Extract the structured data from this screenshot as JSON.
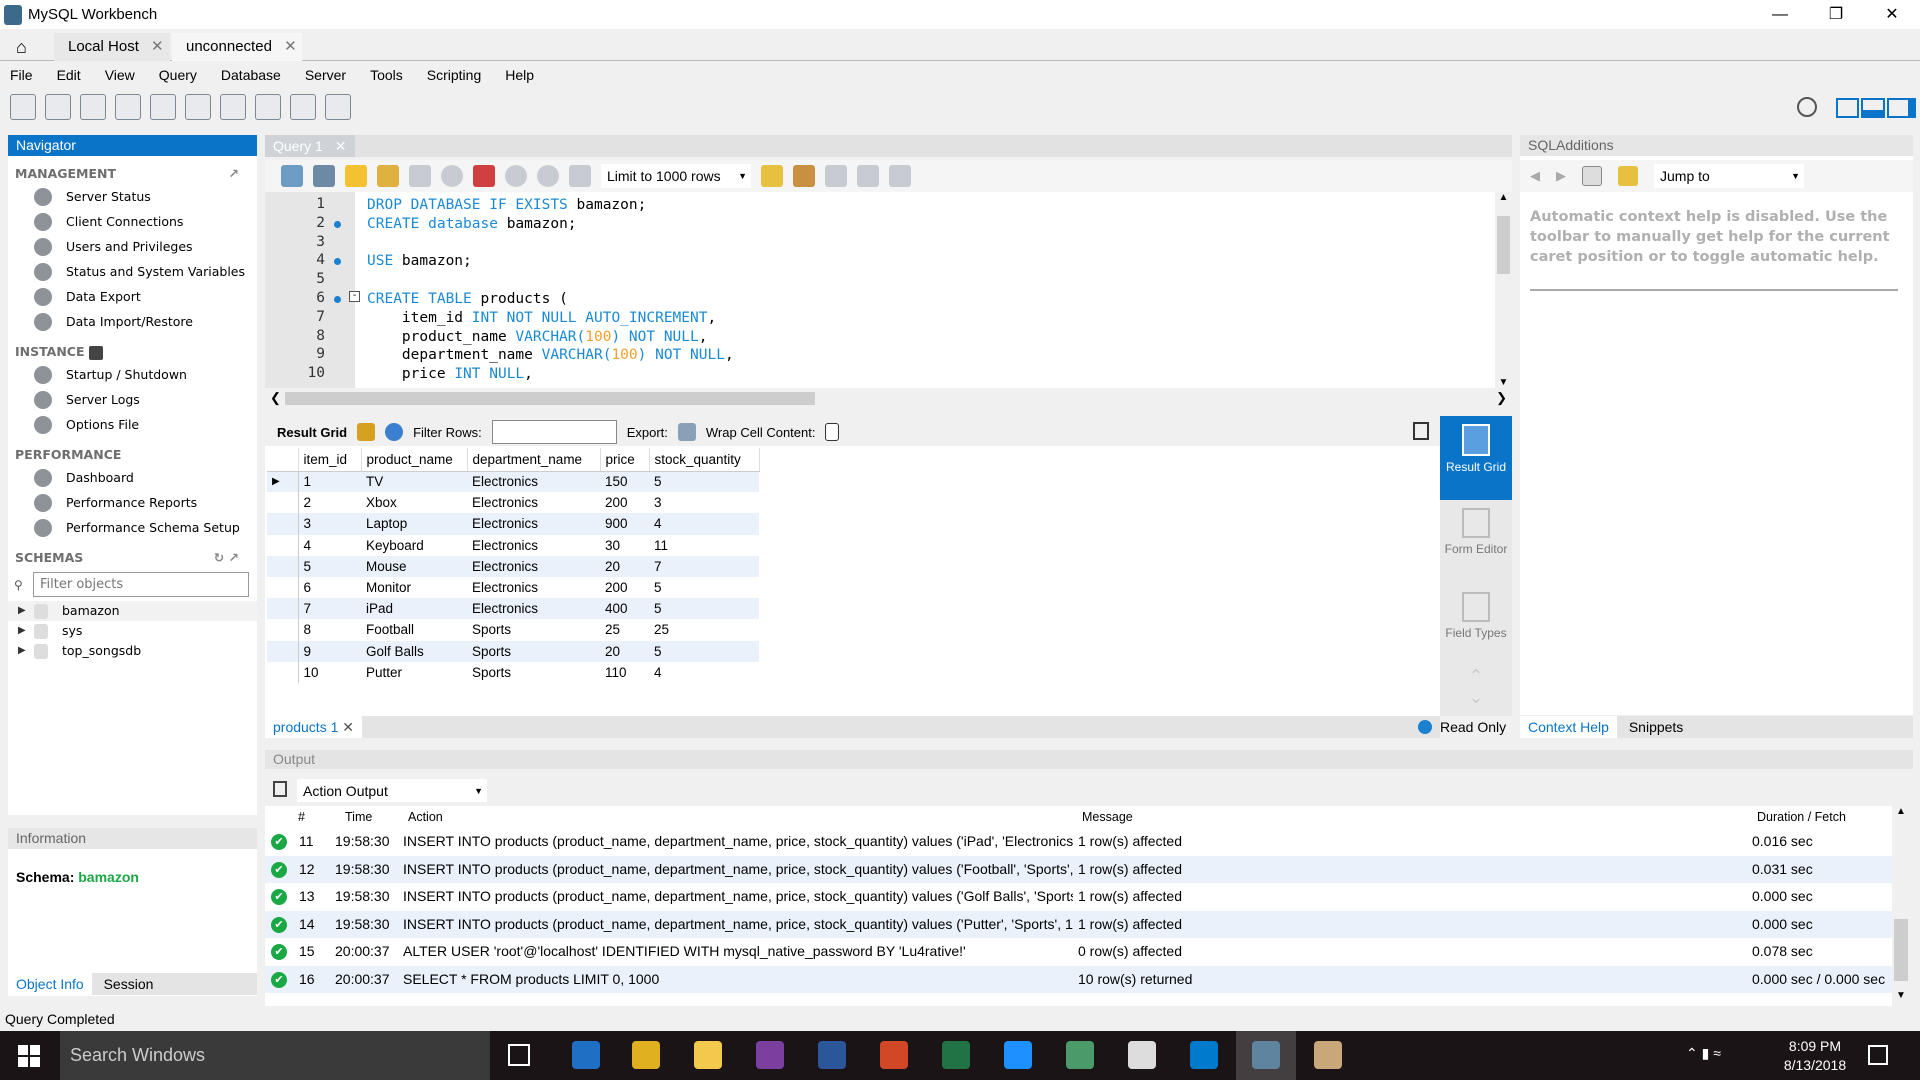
{
  "window": {
    "title": "MySQL Workbench",
    "controls": [
      "minimize",
      "restore",
      "close"
    ]
  },
  "conn_tabs": [
    {
      "label": "Local Host"
    },
    {
      "label": "unconnected"
    }
  ],
  "menu": [
    "File",
    "Edit",
    "View",
    "Query",
    "Database",
    "Server",
    "Tools",
    "Scripting",
    "Help"
  ],
  "navigator": {
    "title": "Navigator",
    "management": {
      "title": "MANAGEMENT",
      "items": [
        "Server Status",
        "Client Connections",
        "Users and Privileges",
        "Status and System Variables",
        "Data Export",
        "Data Import/Restore"
      ]
    },
    "instance": {
      "title": "INSTANCE",
      "items": [
        "Startup / Shutdown",
        "Server Logs",
        "Options File"
      ]
    },
    "performance": {
      "title": "PERFORMANCE",
      "items": [
        "Dashboard",
        "Performance Reports",
        "Performance Schema Setup"
      ]
    },
    "schemas": {
      "title": "SCHEMAS",
      "filter_placeholder": "Filter objects",
      "items": [
        "bamazon",
        "sys",
        "top_songsdb"
      ]
    }
  },
  "information": {
    "title": "Information",
    "schema_label": "Schema:",
    "schema_value": "bamazon",
    "tabs": [
      "Object Info",
      "Session"
    ]
  },
  "query": {
    "tab": "Query 1",
    "limit": "Limit to 1000 rows",
    "code": [
      {
        "n": "1",
        "dot": false,
        "parts": [
          [
            "kw",
            "DROP DATABASE IF EXISTS "
          ],
          [
            "",
            "bamazon;"
          ]
        ]
      },
      {
        "n": "2",
        "dot": true,
        "parts": [
          [
            "kw",
            "CREATE database "
          ],
          [
            "",
            "bamazon;"
          ]
        ]
      },
      {
        "n": "3",
        "dot": false,
        "parts": []
      },
      {
        "n": "4",
        "dot": true,
        "parts": [
          [
            "kw",
            "USE "
          ],
          [
            "",
            "bamazon;"
          ]
        ]
      },
      {
        "n": "5",
        "dot": false,
        "parts": []
      },
      {
        "n": "6",
        "dot": true,
        "parts": [
          [
            "kw",
            "CREATE TABLE "
          ],
          [
            "",
            "products ("
          ]
        ]
      },
      {
        "n": "7",
        "dot": false,
        "parts": [
          [
            "",
            "    item_id "
          ],
          [
            "kw",
            "INT NOT NULL AUTO_INCREMENT"
          ],
          [
            "",
            ","
          ]
        ]
      },
      {
        "n": "8",
        "dot": false,
        "parts": [
          [
            "",
            "    product_name "
          ],
          [
            "kw",
            "VARCHAR("
          ],
          [
            "num",
            "100"
          ],
          [
            "kw",
            ") NOT NULL"
          ],
          [
            "",
            ","
          ]
        ]
      },
      {
        "n": "9",
        "dot": false,
        "parts": [
          [
            "",
            "    department_name "
          ],
          [
            "kw",
            "VARCHAR("
          ],
          [
            "num",
            "100"
          ],
          [
            "kw",
            ") NOT NULL"
          ],
          [
            "",
            ","
          ]
        ]
      },
      {
        "n": "10",
        "dot": false,
        "parts": [
          [
            "",
            "    price "
          ],
          [
            "kw",
            "INT NULL"
          ],
          [
            "",
            ","
          ]
        ]
      }
    ]
  },
  "result": {
    "toolbar": {
      "result_grid": "Result Grid",
      "filter_rows": "Filter Rows:",
      "export": "Export:",
      "wrap": "Wrap Cell Content:"
    },
    "columns": [
      "item_id",
      "product_name",
      "department_name",
      "price",
      "stock_quantity"
    ],
    "rows": [
      [
        "1",
        "TV",
        "Electronics",
        "150",
        "5"
      ],
      [
        "2",
        "Xbox",
        "Electronics",
        "200",
        "3"
      ],
      [
        "3",
        "Laptop",
        "Electronics",
        "900",
        "4"
      ],
      [
        "4",
        "Keyboard",
        "Electronics",
        "30",
        "11"
      ],
      [
        "5",
        "Mouse",
        "Electronics",
        "20",
        "7"
      ],
      [
        "6",
        "Monitor",
        "Electronics",
        "200",
        "5"
      ],
      [
        "7",
        "iPad",
        "Electronics",
        "400",
        "5"
      ],
      [
        "8",
        "Football",
        "Sports",
        "25",
        "25"
      ],
      [
        "9",
        "Golf Balls",
        "Sports",
        "20",
        "5"
      ],
      [
        "10",
        "Putter",
        "Sports",
        "110",
        "4"
      ]
    ],
    "side_buttons": [
      "Result Grid",
      "Form Editor",
      "Field Types"
    ],
    "tab": "products 1",
    "read_only": "Read Only"
  },
  "sql_additions": {
    "title": "SQLAdditions",
    "jump_to": "Jump to",
    "help_text": "Automatic context help is disabled. Use the toolbar to manually get help for the current caret position or to toggle automatic help.",
    "tabs": [
      "Context Help",
      "Snippets"
    ]
  },
  "output": {
    "title": "Output",
    "selector": "Action Output",
    "columns": [
      "#",
      "Time",
      "Action",
      "Message",
      "Duration / Fetch"
    ],
    "rows": [
      {
        "n": "11",
        "time": "19:58:30",
        "action": "INSERT INTO products (product_name, department_name, price, stock_quantity) values ('iPad', 'Electronics', ...",
        "message": "1 row(s) affected",
        "duration": "0.016 sec"
      },
      {
        "n": "12",
        "time": "19:58:30",
        "action": "INSERT INTO products (product_name, department_name, price, stock_quantity) values ('Football', 'Sports', 2...",
        "message": "1 row(s) affected",
        "duration": "0.031 sec"
      },
      {
        "n": "13",
        "time": "19:58:30",
        "action": "INSERT INTO products (product_name, department_name, price, stock_quantity) values ('Golf Balls', 'Sports', ...",
        "message": "1 row(s) affected",
        "duration": "0.000 sec"
      },
      {
        "n": "14",
        "time": "19:58:30",
        "action": "INSERT INTO products (product_name, department_name, price, stock_quantity) values ('Putter', 'Sports', 110...",
        "message": "1 row(s) affected",
        "duration": "0.000 sec"
      },
      {
        "n": "15",
        "time": "20:00:37",
        "action": "ALTER USER 'root'@'localhost' IDENTIFIED WITH mysql_native_password BY 'Lu4rative!'",
        "message": "0 row(s) affected",
        "duration": "0.078 sec"
      },
      {
        "n": "16",
        "time": "20:00:37",
        "action": "SELECT * FROM products LIMIT 0, 1000",
        "message": "10 row(s) returned",
        "duration": "0.000 sec / 0.000 sec"
      }
    ]
  },
  "status": "Query Completed",
  "taskbar": {
    "search": "Search Windows",
    "time": "8:09 PM",
    "date": "8/13/2018",
    "apps": [
      {
        "name": "outlook",
        "color": "#1f6fc5"
      },
      {
        "name": "chrome",
        "color": "#e0b020"
      },
      {
        "name": "file-explorer",
        "color": "#f2c94c"
      },
      {
        "name": "onenote",
        "color": "#7b3fa0"
      },
      {
        "name": "word",
        "color": "#2b579a"
      },
      {
        "name": "powerpoint",
        "color": "#d24726"
      },
      {
        "name": "excel",
        "color": "#217346"
      },
      {
        "name": "internet-explorer",
        "color": "#1e90ff"
      },
      {
        "name": "gitkraken",
        "color": "#4a9a6a"
      },
      {
        "name": "app-badge",
        "color": "#dddddd"
      },
      {
        "name": "vscode",
        "color": "#007acc"
      },
      {
        "name": "mysql-workbench",
        "color": "#3c6a8c"
      },
      {
        "name": "paint",
        "color": "#c8a878"
      }
    ]
  },
  "colors": {
    "accent": "#0a74c8",
    "keyword": "#1a8ad4",
    "number": "#f0a030",
    "success": "#1aa845",
    "schema": "#1aa845"
  }
}
